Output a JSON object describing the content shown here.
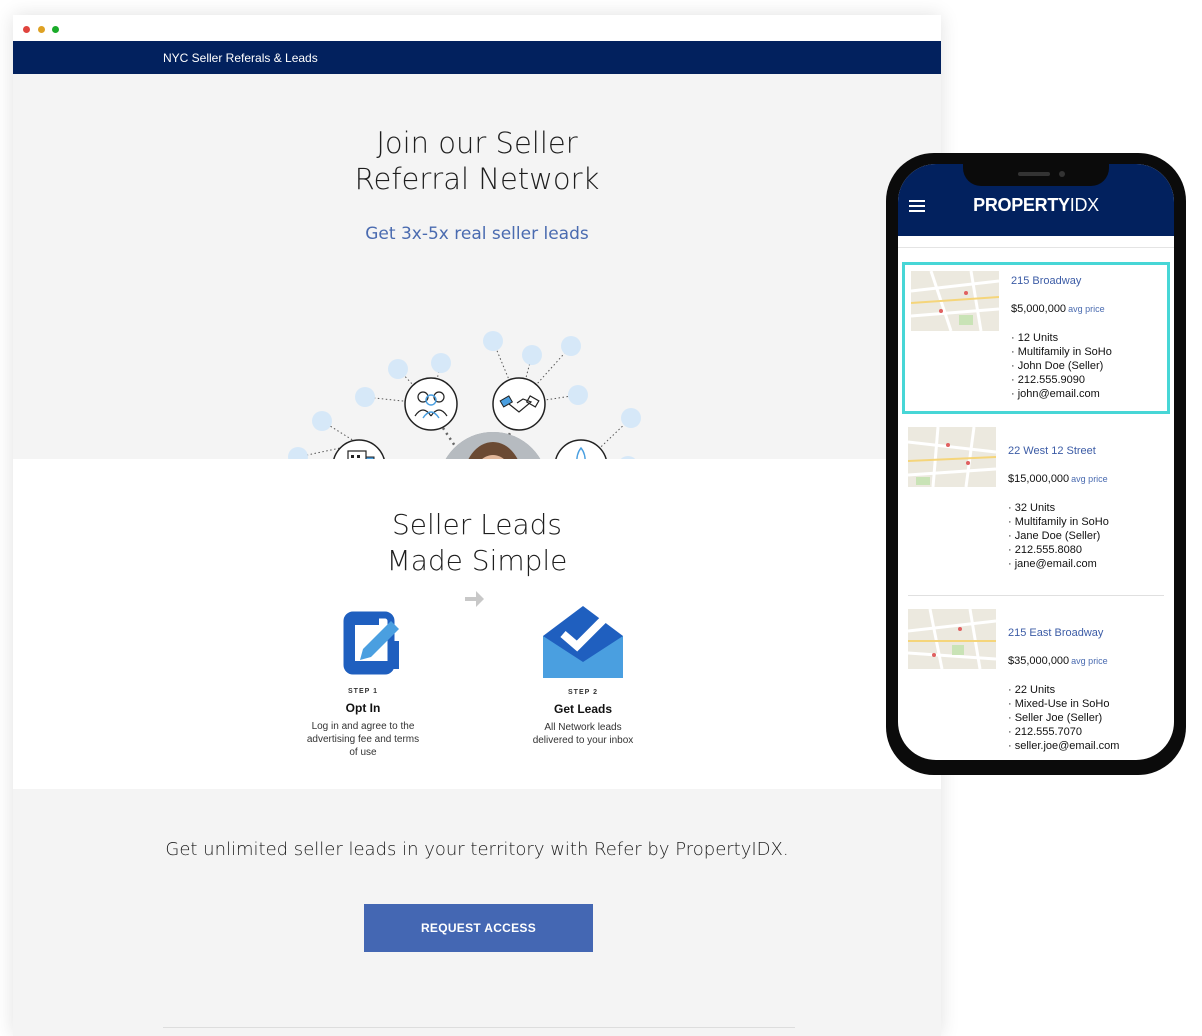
{
  "browser": {
    "nav_title": "NYC Seller Referals & Leads"
  },
  "hero": {
    "title_line1": "Join our Seller",
    "title_line2": "Referral Network",
    "subtitle": "Get 3x-5x real seller leads"
  },
  "section2": {
    "title_line1": "Seller Leads",
    "title_line2": "Made Simple",
    "steps": [
      {
        "label": "STEP 1",
        "name": "Opt In",
        "desc_line1": "Log in and agree to the",
        "desc_line2": "advertising fee and terms",
        "desc_line3": "of use"
      },
      {
        "label": "STEP 2",
        "name": "Get Leads",
        "desc_line1": "All Network leads",
        "desc_line2": "delivered to your inbox",
        "desc_line3": ""
      }
    ]
  },
  "cta": {
    "text": "Get unlimited seller leads in your territory with Refer by PropertyIDX.",
    "button_label": "REQUEST ACCESS"
  },
  "phone": {
    "logo_bold": "PROPERTY",
    "logo_regular": "IDX",
    "listings": [
      {
        "title": "215 Broadway",
        "price": "$5,000,000",
        "price_note": "avg price",
        "units": "· 12 Units",
        "type": "· Multifamily in SoHo",
        "contact": "· John Doe (Seller)",
        "phone": "· 212.555.9090",
        "email": "· john@email.com",
        "selected": true
      },
      {
        "title": "22 West 12 Street",
        "price": "$15,000,000",
        "price_note": "avg price",
        "units": "· 32 Units",
        "type": "· Multifamily in SoHo",
        "contact": "· Jane Doe (Seller)",
        "phone": "· 212.555.8080",
        "email": "· jane@email.com",
        "selected": false
      },
      {
        "title": "215 East Broadway",
        "price": "$35,000,000",
        "price_note": "avg price",
        "units": "· 22 Units",
        "type": "· Mixed-Use in SoHo",
        "contact": "· Seller Joe (Seller)",
        "phone": "· 212.555.7070",
        "email": "· seller.joe@email.com",
        "selected": false
      }
    ]
  },
  "colors": {
    "navy": "#02215e",
    "accent_blue": "#4467b3",
    "selection": "#47d6d6"
  }
}
